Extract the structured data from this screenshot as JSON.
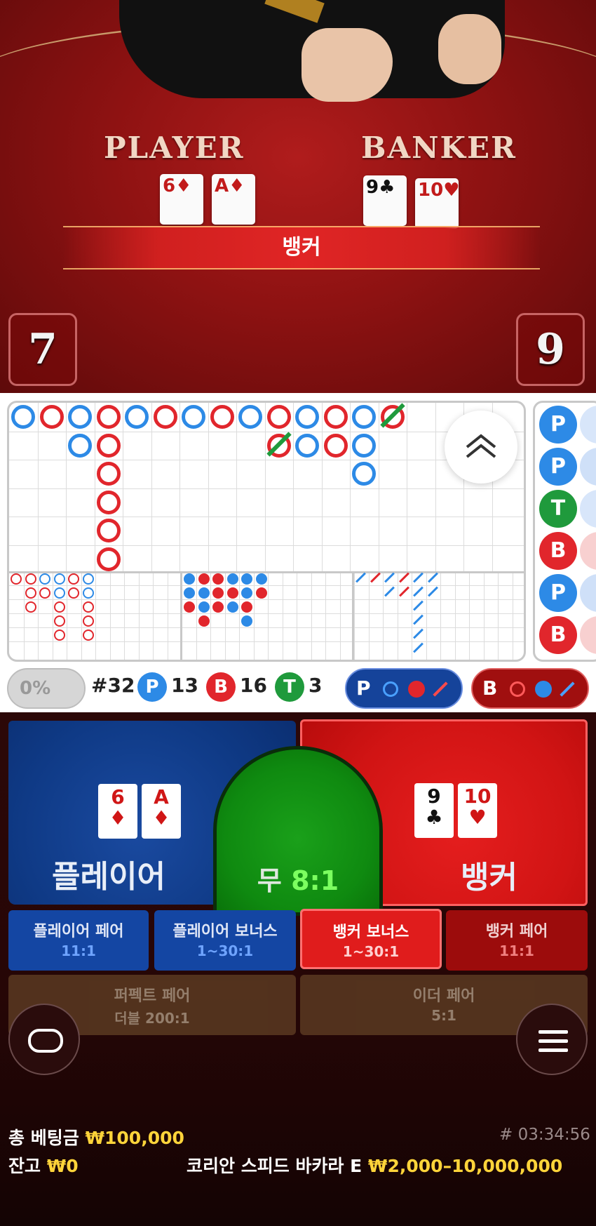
{
  "table": {
    "player_label": "PLAYER",
    "banker_label": "BANKER",
    "player_cards": [
      {
        "rank": "6",
        "suit": "♦"
      },
      {
        "rank": "A",
        "suit": "♦"
      }
    ],
    "banker_cards": [
      {
        "rank": "9",
        "suit": "♣"
      },
      {
        "rank": "10",
        "suit": "♥"
      }
    ],
    "winner": "뱅커",
    "player_score": "7",
    "banker_score": "9"
  },
  "stats": {
    "percent": "0%",
    "round": "#32",
    "p_letter": "P",
    "p_count": "13",
    "b_letter": "B",
    "b_count": "16",
    "t_letter": "T",
    "t_count": "3",
    "predict_p_letter": "P",
    "predict_b_letter": "B"
  },
  "side_column": [
    "P",
    "P",
    "T",
    "B",
    "P",
    "B"
  ],
  "bets": {
    "player_name": "플레이어",
    "banker_name": "뱅커",
    "tie_name": "무",
    "tie_odds": "8:1",
    "player_cards": [
      {
        "rank": "6",
        "suit": "♦"
      },
      {
        "rank": "A",
        "suit": "♦"
      }
    ],
    "banker_cards": [
      {
        "rank": "9",
        "suit": "♣"
      },
      {
        "rank": "10",
        "suit": "♥"
      }
    ],
    "side": [
      {
        "name": "플레이어 페어",
        "odds": "11:1"
      },
      {
        "name": "플레이어 보너스",
        "odds": "1~30:1"
      },
      {
        "name": "뱅커 보너스",
        "odds": "1~30:1"
      },
      {
        "name": "뱅커 페어",
        "odds": "11:1"
      },
      {
        "name": "퍼펙트 페어",
        "odds": "더블 200:1"
      },
      {
        "name": "이더 페어",
        "odds": "5:1"
      }
    ]
  },
  "footer": {
    "total_bet_label": "총 베팅금",
    "total_bet_value": "₩100,000",
    "balance_label": "잔고",
    "balance_value": "₩0",
    "round_id": "# 03:34:56",
    "table_name": "코리안 스피드 바카라 E",
    "limits": "₩2,000–10,000,000"
  },
  "colors": {
    "player": "#2d8ae6",
    "banker": "#e1262c",
    "tie": "#1f9a3c",
    "gold": "#ffd43a"
  },
  "icons": {
    "collapse": "chevron-double-up-icon",
    "chat": "chat-icon",
    "menu": "hamburger-menu-icon"
  }
}
